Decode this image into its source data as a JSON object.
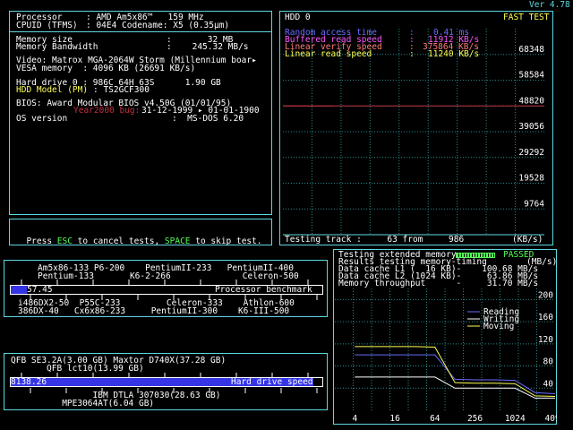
{
  "version": "Ver 4.78",
  "system": {
    "processor_label": "Processor",
    "processor_value": ": AMD Am5x86™   159 MHz",
    "cpuid_label": "CPUID (TFMS)",
    "cpuid_value": ": 04E4 Codename: X5 (0.35µm)",
    "memsize_label": "Memory size",
    "memsize_value": ":       32 MB",
    "membw_label": "Memory Bandwidth",
    "membw_value": ":    245.32 MB/s",
    "video_line": "Video: Matrox MGA-2064W Storm (Millennium boar▸",
    "vesa_line": "VESA memory  : 4096 KB (26691 KB/s)",
    "hdd_line": "Hard drive 0 : 986C 64H 63S      1.90 GB",
    "hddmodel_label": "HDD Model (PM)",
    "hddmodel_value": ": TS2GCF300",
    "bios_line": "BIOS: Award Modular BIOS v4.50G (01/01/95)",
    "y2k_label": "Year2000 bug:",
    "y2k_value": "31-12-1999 ▸ 01-01-1900",
    "os_label": "OS version",
    "os_value": ":  MS-DOS 6.20"
  },
  "hint": {
    "press": "Press ",
    "esc": "ESC",
    "cancel": " to cancel tests, ",
    "space": "SPACE",
    "skip": " to skip test."
  },
  "hdd_test": {
    "title": "HDD 0",
    "mode": "FAST TEST",
    "rows": [
      {
        "label": "Random access time",
        "sep": ":",
        "value": "0.41 ms"
      },
      {
        "label": "Buffered read speed",
        "sep": ":",
        "value": "11912 KB/s"
      },
      {
        "label": "Linear verify speed",
        "sep": ":",
        "value": "375864 KB/s"
      },
      {
        "label": "Linear read speed",
        "sep": ":",
        "value": "11240 KB/s"
      }
    ],
    "status_text": "Testing track :     63 from     986",
    "unit": "(KB/s)",
    "chart_data": {
      "type": "line",
      "y_tick_labels": [
        "68348",
        "58584",
        "48820",
        "39056",
        "29292",
        "19528",
        "9764"
      ],
      "ylim": [
        0,
        78112
      ],
      "series": [
        {
          "values": [
            48820,
            48820,
            48820,
            48820,
            48820,
            48820,
            48820,
            48820,
            48820,
            48820
          ]
        }
      ],
      "grid": true
    }
  },
  "mem_test": {
    "status": "Testing extended memory...",
    "passed": "PASSED",
    "results_title": "Results testing memory-timing",
    "unit": "(MB/s)",
    "l1_line": "Data cache L1 (  16 KB)-    100.68 MB/s",
    "l2_line": "Data cache L2 (1024 KB)-     63.86 MB/s",
    "mem_line": "Memory throughput      -     31.70 MB/s",
    "chart_data": {
      "type": "line",
      "x_tick_labels": [
        "4",
        "16",
        "64",
        "256",
        "1024",
        "4096"
      ],
      "y_tick_labels": [
        "200",
        "160",
        "120",
        "80",
        "40"
      ],
      "ylim": [
        0,
        220
      ],
      "xlim_log2": [
        1,
        12
      ],
      "series": [
        {
          "name": "Reading",
          "color": "#6a6aff",
          "x": [
            2,
            3,
            4,
            5,
            6,
            7,
            8,
            9,
            10,
            11,
            12
          ],
          "y": [
            100,
            100,
            100,
            100,
            100,
            56,
            55,
            55,
            54,
            32,
            30
          ]
        },
        {
          "name": "Writing",
          "color": "#ffffff",
          "x": [
            2,
            3,
            4,
            5,
            6,
            7,
            8,
            9,
            10,
            11,
            12
          ],
          "y": [
            60,
            60,
            60,
            60,
            60,
            40,
            40,
            40,
            40,
            22,
            22
          ]
        },
        {
          "name": "Moving",
          "color": "#ffff55",
          "x": [
            2,
            3,
            4,
            5,
            6,
            7,
            8,
            9,
            10,
            11,
            12
          ],
          "y": [
            115,
            115,
            115,
            115,
            114,
            50,
            49,
            49,
            48,
            26,
            25
          ]
        }
      ]
    }
  },
  "cpu_bench": {
    "above_labels": [
      "Am5x86-133 P6-200    PentiumII-233   PentiumII-400",
      "Pentium-133       K6-2-266              Celeron-500"
    ],
    "value": "57.45",
    "bar_label": "Processor benchmark",
    "bar_fraction": 0.052,
    "below_labels": [
      "i486DX2-50  P55C-233         Celeron-333    Athlon-600",
      "386DX-40   Cx6x86-233     PentiumII-300    K6-III-500"
    ]
  },
  "hd_bench": {
    "above_labels": [
      "QFB SE3.2A(3.00 GB) Maxtor D740X(37.28 GB)",
      "       QFB lct10(13.99 GB)"
    ],
    "value": "8138.26",
    "bar_label": "Hard drive speed",
    "bar_fraction": 0.97,
    "below_labels": [
      "                IBM DTLA 307030(28.63 GB)",
      "          MPE3064AT(6.04 GB)"
    ]
  }
}
